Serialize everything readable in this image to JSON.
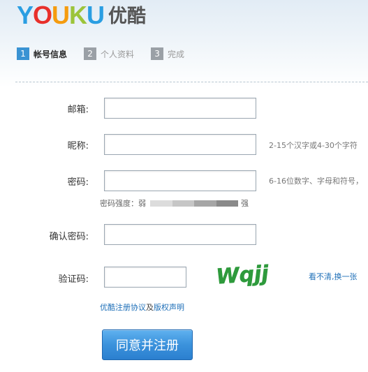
{
  "brand": {
    "logo_en": [
      "Y",
      "O",
      "U",
      "K",
      "U"
    ],
    "logo_cn": "优酷"
  },
  "steps": [
    {
      "num": "1",
      "label": "帐号信息",
      "active": true
    },
    {
      "num": "2",
      "label": "个人资料",
      "active": false
    },
    {
      "num": "3",
      "label": "完成",
      "active": false
    }
  ],
  "form": {
    "email_label": "邮箱:",
    "email_value": "",
    "nickname_label": "昵称:",
    "nickname_value": "",
    "nickname_hint": "2-15个汉字或4-30个字符",
    "password_label": "密码:",
    "password_value": "",
    "password_hint": "6-16位数字、字母和符号，",
    "strength_label": "密码强度：弱",
    "strength_strong": "强",
    "confirm_label": "确认密码:",
    "confirm_value": "",
    "captcha_label": "验证码:",
    "captcha_value": "",
    "captcha_text": "Wqjj",
    "refresh_link": "看不清,换一张"
  },
  "agreement": {
    "link1": "优酷注册协议",
    "connector": "及",
    "link2": "版权声明"
  },
  "submit_label": "同意并注册",
  "colors": {
    "accent": "#3a93d3",
    "captcha_green": "#2e9a3c",
    "link": "#1e6fb8"
  }
}
